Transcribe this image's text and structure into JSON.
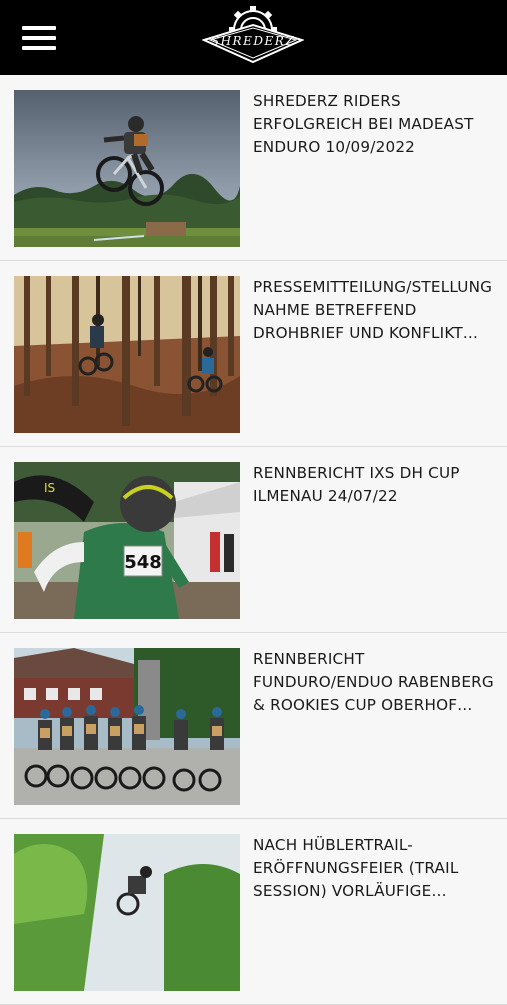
{
  "header": {
    "menu_icon": "hamburger-menu-icon",
    "logo_text": "SHREDERZ",
    "background": "#000000"
  },
  "posts": [
    {
      "title": "SHREDERZ RIDERS ERFOLGREICH BEI MADEAST ENDURO 10/09/2022",
      "image": "jumping-rider-photo"
    },
    {
      "title": "PRESSEMITTEILUNG/STELLUNG NAHME BETREFFEND DROHBRIEF UND KONFLIKT…",
      "image": "forest-riders-photo"
    },
    {
      "title": "RENNBERICHT IXS DH CUP ILMENAU 24/07/22",
      "image": "race-number-rider-photo",
      "race_number": "548"
    },
    {
      "title": "RENNBERICHT FUNDURO/ENDUO RABENBERG & ROOKIES CUP OBERHOF…",
      "image": "kids-group-photo"
    },
    {
      "title": "NACH HÜBLERTRAIL-ERÖFFNUNGSFEIER (TRAIL SESSION) VORLÄUFIGE…",
      "image": "trail-session-photo"
    }
  ]
}
